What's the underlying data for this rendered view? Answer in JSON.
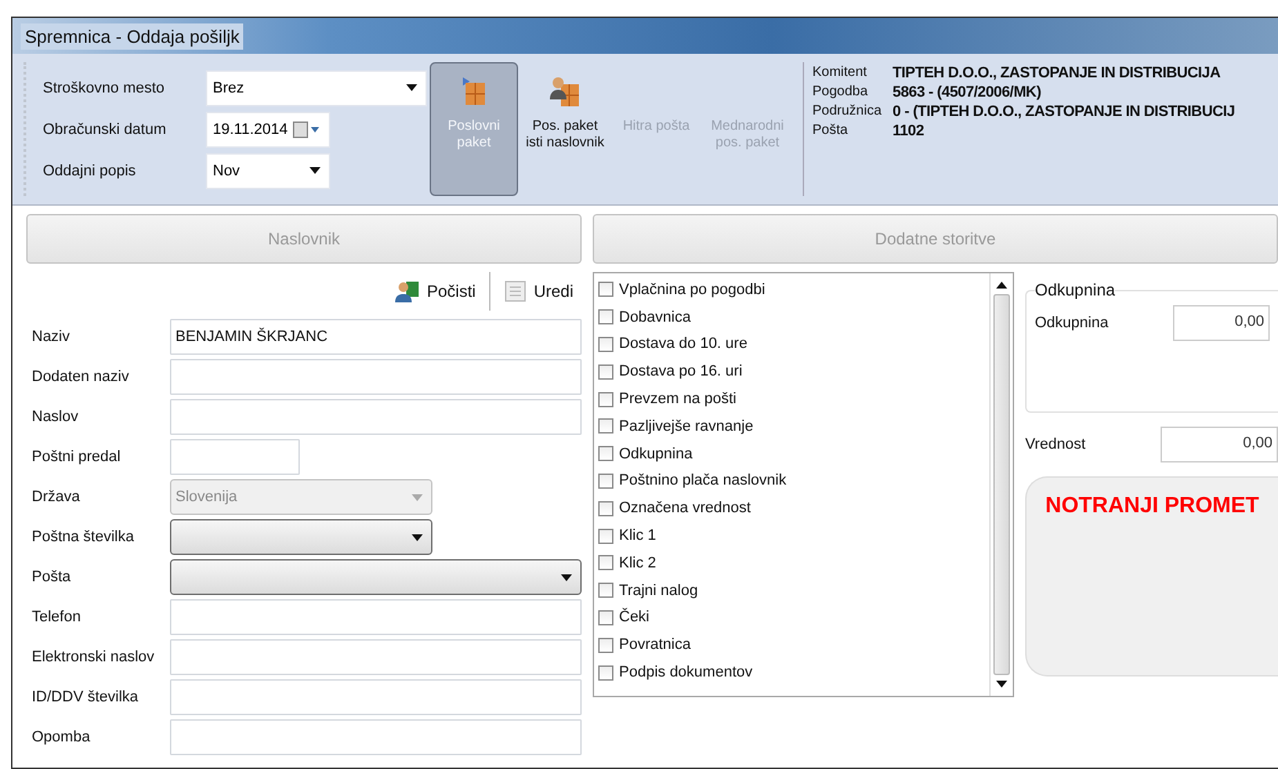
{
  "window": {
    "title": "Spremnica - Oddaja pošiljk"
  },
  "header_fields": [
    {
      "label": "Stroškovno mesto",
      "value": "Brez",
      "kind": "select"
    },
    {
      "label": "Obračunski datum",
      "value": "19.11.2014",
      "kind": "date"
    },
    {
      "label": "Oddajni popis",
      "value": "Nov",
      "kind": "select"
    }
  ],
  "tool_buttons": [
    {
      "label": "Poslovni paket",
      "selected": true,
      "disabled": false
    },
    {
      "label": "Pos. paket isti naslovnik",
      "selected": false,
      "disabled": false
    },
    {
      "label": "Hitra pošta",
      "selected": false,
      "disabled": true
    },
    {
      "label": "Mednarodni pos. paket",
      "selected": false,
      "disabled": true
    }
  ],
  "info": [
    {
      "label": "Komitent",
      "value": "TIPTEH D.O.O., ZASTOPANJE IN DISTRIBUCIJA"
    },
    {
      "label": "Pogodba",
      "value": "5863 - (4507/2006/MK)"
    },
    {
      "label": "Podružnica",
      "value": "0 - (TIPTEH D.O.O., ZASTOPANJE IN DISTRIBUCIJ"
    },
    {
      "label": "Pošta",
      "value": "1102"
    }
  ],
  "recipient": {
    "header": "Naslovnik",
    "actions": [
      {
        "label": "Počisti"
      },
      {
        "label": "Uredi"
      }
    ],
    "fields": [
      {
        "label": "Naziv",
        "value": "BENJAMIN ŠKRJANC",
        "kind": "text",
        "disabled": false
      },
      {
        "label": "Dodaten naziv",
        "kind": "text",
        "disabled": false
      },
      {
        "label": "Naslov",
        "kind": "text",
        "disabled": false
      },
      {
        "label": "Poštni predal",
        "kind": "text",
        "disabled": false
      },
      {
        "label": "Država",
        "value": "Slovenija",
        "kind": "select",
        "disabled": true
      },
      {
        "label": "Poštna številka",
        "kind": "select",
        "disabled": false
      },
      {
        "label": "Pošta",
        "kind": "select",
        "disabled": false
      },
      {
        "label": "Telefon",
        "kind": "text",
        "disabled": false
      },
      {
        "label": "Elektronski naslov",
        "kind": "text",
        "disabled": false
      },
      {
        "label": "ID/DDV številka",
        "kind": "text",
        "disabled": false
      },
      {
        "label": "Opomba",
        "kind": "text",
        "disabled": false
      }
    ]
  },
  "services": {
    "header": "Dodatne storitve",
    "options": [
      {
        "label": "Vplačnina po pogodbi",
        "checked": false
      },
      {
        "label": "Dobavnica",
        "checked": false
      },
      {
        "label": "Dostava do 10. ure",
        "checked": false
      },
      {
        "label": "Dostava po 16. uri",
        "checked": false
      },
      {
        "label": "Prevzem na pošti",
        "checked": false
      },
      {
        "label": "Pazljivejše ravnanje",
        "checked": false
      },
      {
        "label": "Odkupnina",
        "checked": false
      },
      {
        "label": "Poštnino plača naslovnik",
        "checked": false
      },
      {
        "label": "Označena vrednost",
        "checked": false
      },
      {
        "label": "Klic 1",
        "checked": false
      },
      {
        "label": "Klic 2",
        "checked": false
      },
      {
        "label": "Trajni nalog",
        "checked": false
      },
      {
        "label": "Čeki",
        "checked": false
      },
      {
        "label": "Povratnica",
        "checked": false
      },
      {
        "label": "Podpis dokumentov",
        "checked": false
      }
    ],
    "cod_group": {
      "title": "Odkupnina",
      "label": "Odkupnina",
      "value": "0,00"
    },
    "value_field": {
      "label": "Vrednost",
      "value": "0,00"
    },
    "notice": "NOTRANJI PROMET"
  }
}
